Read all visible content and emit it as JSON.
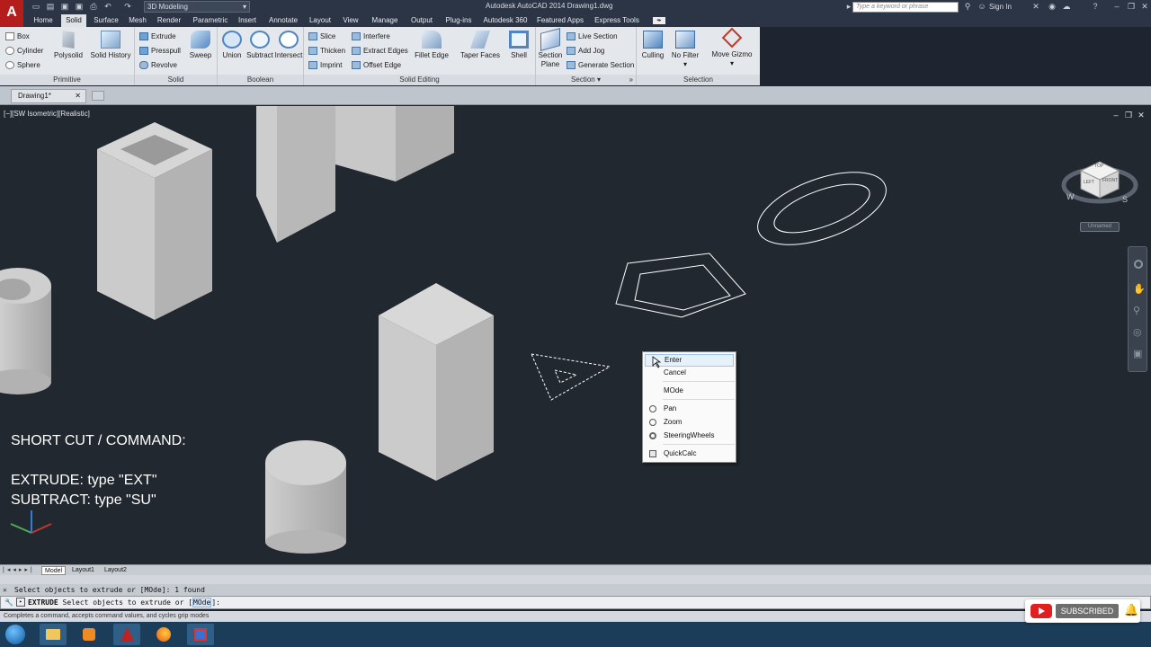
{
  "titlebar": {
    "app_logo": "A",
    "workspace": "3D Modeling",
    "title": "Autodesk AutoCAD 2014    Drawing1.dwg",
    "search_placeholder": "Type a keyword or phrase",
    "sign_in": "Sign In"
  },
  "tabs": [
    "Home",
    "Solid",
    "Surface",
    "Mesh",
    "Render",
    "Parametric",
    "Insert",
    "Annotate",
    "Layout",
    "View",
    "Manage",
    "Output",
    "Plug-ins",
    "Autodesk 360",
    "Featured Apps",
    "Express Tools"
  ],
  "active_tab": "Solid",
  "ribbon": {
    "primitive": {
      "title": "Primitive",
      "items": [
        "Box",
        "Cylinder",
        "Sphere"
      ],
      "polysolid": "Polysolid",
      "solid_history": "Solid History"
    },
    "solid": {
      "title": "Solid",
      "items": [
        "Extrude",
        "Presspull",
        "Revolve"
      ],
      "sweep": "Sweep"
    },
    "boolean": {
      "title": "Boolean",
      "union": "Union",
      "subtract": "Subtract",
      "intersect": "Intersect"
    },
    "solid_editing": {
      "title": "Solid Editing",
      "col1": [
        "Slice",
        "Thicken",
        "Imprint"
      ],
      "col2": [
        "Interfere",
        "Extract Edges",
        "Offset Edge"
      ],
      "fillet_edge": "Fillet Edge",
      "taper_faces": "Taper Faces",
      "shell": "Shell"
    },
    "section": {
      "title": "Section",
      "section_plane_1": "Section",
      "section_plane_2": "Plane",
      "items": [
        "Live Section",
        "Add Jog",
        "Generate Section"
      ]
    },
    "selection": {
      "title": "Selection",
      "culling": "Culling",
      "no_filter": "No Filter",
      "move_gizmo": "Move Gizmo"
    }
  },
  "file_tab": "Drawing1*",
  "viewport": {
    "label": "[−][SW Isometric][Realistic]",
    "overlay_lines": [
      "SHORT CUT / COMMAND:",
      "",
      "EXTRUDE: type \"EXT\"",
      "SUBTRACT: type \"SU\""
    ],
    "viewcube": {
      "top": "TOP",
      "left": "LEFT",
      "front": "FRONT",
      "w": "W",
      "s": "S",
      "ucs": "Unnamed"
    }
  },
  "context_menu": [
    "Enter",
    "Cancel",
    "MOde",
    "Pan",
    "Zoom",
    "SteeringWheels",
    "QuickCalc"
  ],
  "layout_tabs": [
    "Model",
    "Layout1",
    "Layout2"
  ],
  "command": {
    "history": "Select objects to extrude or [MOde]: 1 found",
    "prompt_cmd": "EXTRUDE",
    "prompt_text": "Select objects to extrude or [",
    "prompt_opt": "MOde",
    "prompt_end": "]:"
  },
  "status_text": "Completes a command, accepts command values, and cycles grip modes",
  "subscribed": "SUBSCRIBED",
  "colors": {
    "accent": "#b51d1d",
    "viewport_bg": "#212830"
  }
}
